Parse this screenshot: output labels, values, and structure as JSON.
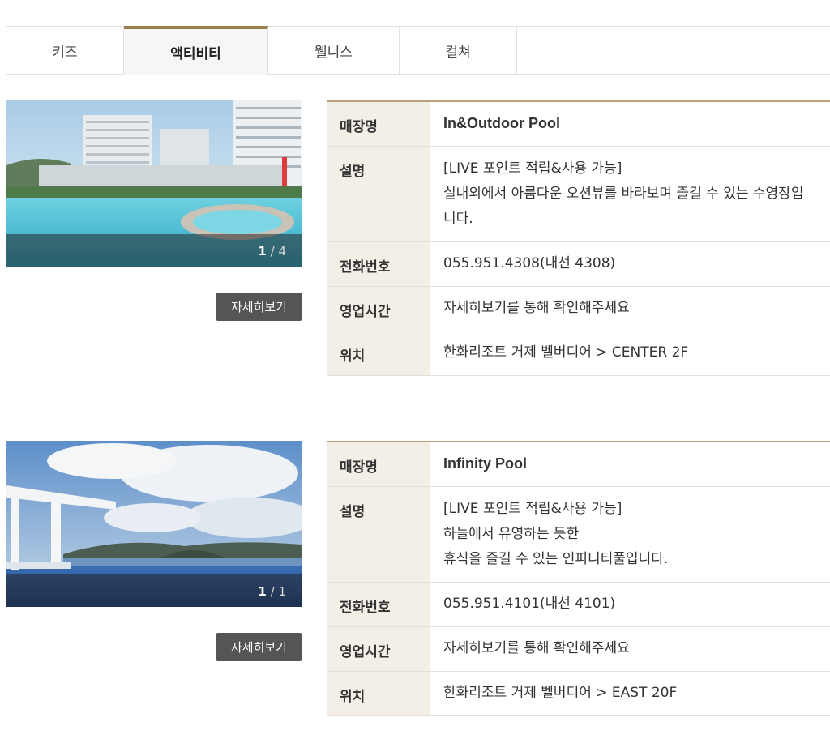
{
  "tabs": [
    {
      "label": "키즈",
      "active": false
    },
    {
      "label": "액티비티",
      "active": true
    },
    {
      "label": "웰니스",
      "active": false
    },
    {
      "label": "컬쳐",
      "active": false
    }
  ],
  "field_labels": {
    "name": "매장명",
    "description": "설명",
    "phone": "전화번호",
    "hours": "영업시간",
    "location": "위치"
  },
  "facilities": [
    {
      "name": "In&Outdoor Pool",
      "description_lines": [
        "[LIVE 포인트 적립&사용 가능]",
        "실내외에서 아름다운 오션뷰를 바라보며 즐길 수 있는 수영장입",
        "니다."
      ],
      "phone": "055.951.4308(내선 4308)",
      "hours": "자세히보기를 통해 확인해주세요",
      "location": "한화리조트 거제 벨버디어 > CENTER 2F",
      "photo_current": "1",
      "photo_sep": " / ",
      "photo_total": "4",
      "detail_button": "자세히보기"
    },
    {
      "name": "Infinity Pool",
      "description_lines": [
        "[LIVE 포인트 적립&사용 가능]",
        "하늘에서 유영하는 듯한",
        "휴식을 즐길 수 있는 인피니티풀입니다."
      ],
      "phone": "055.951.4101(내선 4101)",
      "hours": "자세히보기를 통해 확인해주세요",
      "location": "한화리조트 거제 벨버디어 > EAST 20F",
      "photo_current": "1",
      "photo_sep": " / ",
      "photo_total": "1",
      "detail_button": "자세히보기"
    }
  ],
  "colors": {
    "accent": "#9d7e4e",
    "label_bg": "#f3efe7",
    "button_bg": "#555555"
  }
}
